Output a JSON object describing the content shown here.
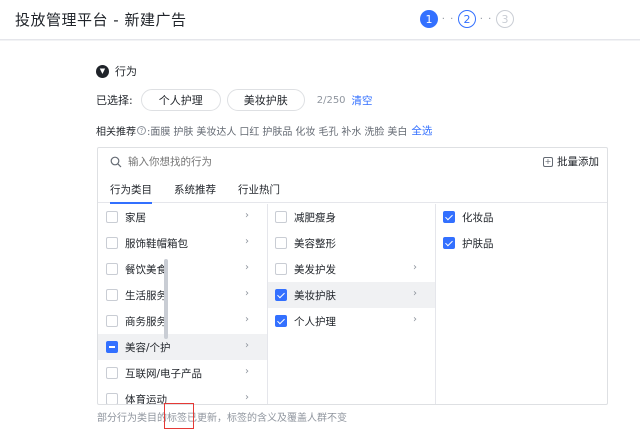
{
  "header": {
    "title": "投放管理平台 - 新建广告",
    "steps": [
      {
        "label": "1",
        "state": "active"
      },
      {
        "label": "2",
        "state": "next"
      },
      {
        "label": "3",
        "state": "todo"
      }
    ],
    "dots": "· ·"
  },
  "section": {
    "title": "行为",
    "selected_label": "已选择:",
    "chips": [
      "个人护理",
      "美妆护肤"
    ],
    "count": "2/250",
    "clear_label": "清空",
    "rec_label": "相关推荐",
    "rec_keywords": [
      ":面膜",
      "护肤",
      "美妆达人",
      "口红",
      "护肤品",
      "化妆",
      "毛孔",
      "补水",
      "洗脸",
      "美白"
    ],
    "select_all": "全选"
  },
  "search": {
    "placeholder": "输入你想找的行为",
    "bulk_add": "批量添加"
  },
  "tabs": [
    "行为类目",
    "系统推荐",
    "行业热门"
  ],
  "columns": {
    "level1": [
      {
        "label": "家居",
        "state": "unchecked",
        "arrow": true
      },
      {
        "label": "服饰鞋帽箱包",
        "state": "unchecked",
        "arrow": true
      },
      {
        "label": "餐饮美食",
        "state": "unchecked",
        "arrow": true
      },
      {
        "label": "生活服务",
        "state": "unchecked",
        "arrow": true
      },
      {
        "label": "商务服务",
        "state": "unchecked",
        "arrow": true
      },
      {
        "label": "美容/个护",
        "state": "half",
        "arrow": true,
        "highlight": true
      },
      {
        "label": "互联网/电子产品",
        "state": "unchecked",
        "arrow": true
      },
      {
        "label": "体育运动",
        "state": "unchecked",
        "arrow": true
      }
    ],
    "level2": [
      {
        "label": "减肥瘦身",
        "state": "unchecked",
        "arrow": false
      },
      {
        "label": "美容整形",
        "state": "unchecked",
        "arrow": false
      },
      {
        "label": "美发护发",
        "state": "unchecked",
        "arrow": true
      },
      {
        "label": "美妆护肤",
        "state": "checked",
        "arrow": true,
        "highlight": true
      },
      {
        "label": "个人护理",
        "state": "checked",
        "arrow": true
      }
    ],
    "level3": [
      {
        "label": "化妆品",
        "state": "checked"
      },
      {
        "label": "护肤品",
        "state": "checked"
      }
    ]
  },
  "footer": {
    "note": "部分行为类目的标签已更新，标签的含义及覆盖人群不变"
  },
  "colors": {
    "accent": "#3370ff",
    "highlight_box": "#e53935"
  }
}
